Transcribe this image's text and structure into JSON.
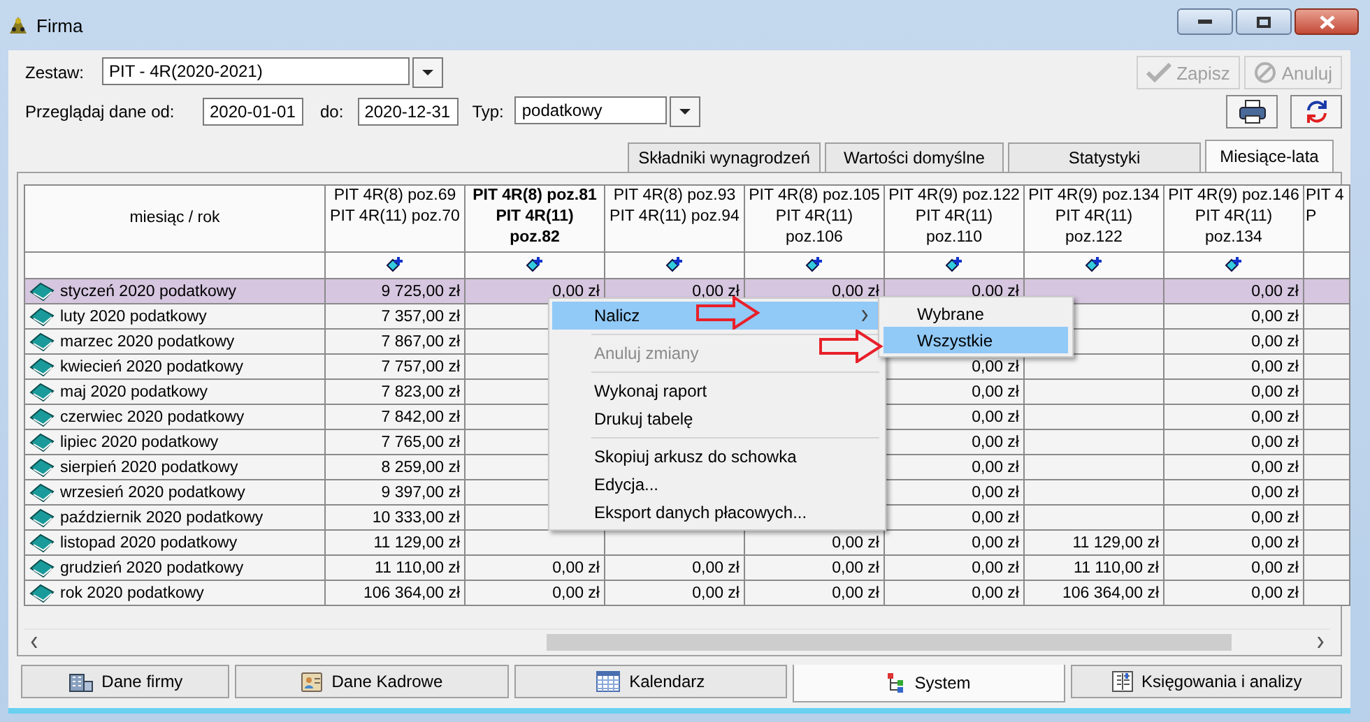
{
  "window": {
    "title": "Firma"
  },
  "form": {
    "set_label": "Zestaw:",
    "set_value": "PIT - 4R(2020-2021)",
    "from_label": "Przeglądaj dane od:",
    "from_value": "2020-01-01",
    "to_label": "do:",
    "to_value": "2020-12-31",
    "type_label": "Typ:",
    "type_value": "podatkowy"
  },
  "buttons": [
    {
      "label": "Zapisz",
      "disabled": true
    },
    {
      "label": "Anuluj",
      "disabled": true
    }
  ],
  "tabs": [
    {
      "label": "Składniki wynagrodzeń",
      "selected": false
    },
    {
      "label": "Wartości domyślne",
      "selected": false
    },
    {
      "label": "Statystyki",
      "selected": false
    },
    {
      "label": "Miesiące-lata",
      "selected": true
    }
  ],
  "table": {
    "corner_label": "miesiąc / rok",
    "columns": [
      {
        "label": "PIT 4R(8) poz.69\nPIT 4R(11) poz.70",
        "selected": false
      },
      {
        "label": "PIT 4R(8) poz.81\nPIT 4R(11)\npoz.82",
        "selected": true
      },
      {
        "label": "PIT 4R(8) poz.93\nPIT 4R(11) poz.94",
        "selected": false
      },
      {
        "label": "PIT 4R(8) poz.105\nPIT 4R(11)\npoz.106",
        "selected": false
      },
      {
        "label": "PIT 4R(9) poz.122\nPIT 4R(11)\npoz.110",
        "selected": false
      },
      {
        "label": "PIT 4R(9) poz.134\nPIT 4R(11)\npoz.122",
        "selected": false
      },
      {
        "label": "PIT 4R(9) poz.146\nPIT 4R(11)\npoz.134",
        "selected": false
      },
      {
        "label": "PIT 4\nP",
        "selected": false
      }
    ],
    "rows": [
      {
        "label": "styczeń 2020 podatkowy",
        "selected": true,
        "cells": [
          "9 725,00 zł",
          "0,00 zł",
          "0,00 zł",
          "0,00 zł",
          "0,00 zł",
          null,
          "0,00 zł"
        ]
      },
      {
        "label": "luty 2020 podatkowy",
        "selected": false,
        "cells": [
          "7 357,00 zł",
          null,
          null,
          null,
          null,
          null,
          "0,00 zł"
        ]
      },
      {
        "label": "marzec 2020 podatkowy",
        "selected": false,
        "cells": [
          "7 867,00 zł",
          null,
          null,
          null,
          null,
          null,
          "0,00 zł"
        ]
      },
      {
        "label": "kwiecień 2020 podatkowy",
        "selected": false,
        "cells": [
          "7 757,00 zł",
          null,
          null,
          null,
          "0,00 zł",
          null,
          "0,00 zł"
        ]
      },
      {
        "label": "maj 2020 podatkowy",
        "selected": false,
        "cells": [
          "7 823,00 zł",
          null,
          null,
          null,
          "0,00 zł",
          null,
          "0,00 zł"
        ]
      },
      {
        "label": "czerwiec 2020 podatkowy",
        "selected": false,
        "cells": [
          "7 842,00 zł",
          null,
          null,
          null,
          "0,00 zł",
          null,
          "0,00 zł"
        ]
      },
      {
        "label": "lipiec 2020 podatkowy",
        "selected": false,
        "cells": [
          "7 765,00 zł",
          null,
          null,
          null,
          "0,00 zł",
          null,
          "0,00 zł"
        ]
      },
      {
        "label": "sierpień 2020 podatkowy",
        "selected": false,
        "cells": [
          "8 259,00 zł",
          null,
          null,
          null,
          "0,00 zł",
          null,
          "0,00 zł"
        ]
      },
      {
        "label": "wrzesień 2020 podatkowy",
        "selected": false,
        "cells": [
          "9 397,00 zł",
          null,
          null,
          null,
          "0,00 zł",
          null,
          "0,00 zł"
        ]
      },
      {
        "label": "październik 2020 podatkowy",
        "selected": false,
        "cells": [
          "10 333,00 zł",
          null,
          null,
          null,
          "0,00 zł",
          null,
          "0,00 zł"
        ]
      },
      {
        "label": "listopad 2020 podatkowy",
        "selected": false,
        "cells": [
          "11 129,00 zł",
          null,
          null,
          "0,00 zł",
          "0,00 zł",
          "11 129,00 zł",
          "0,00 zł"
        ]
      },
      {
        "label": "grudzień 2020 podatkowy",
        "selected": false,
        "cells": [
          "11 110,00 zł",
          "0,00 zł",
          "0,00 zł",
          "0,00 zł",
          "0,00 zł",
          "11 110,00 zł",
          "0,00 zł"
        ]
      },
      {
        "label": "rok 2020 podatkowy",
        "selected": false,
        "cells": [
          "106 364,00 zł",
          "0,00 zł",
          "0,00 zł",
          "0,00 zł",
          "0,00 zł",
          "106 364,00 zł",
          "0,00 zł"
        ]
      }
    ]
  },
  "context_menu": {
    "items": [
      {
        "kind": "item",
        "label": "Nalicz",
        "selected": true,
        "disabled": false,
        "submenu": true
      },
      {
        "kind": "separator"
      },
      {
        "kind": "item",
        "label": "Anuluj zmiany",
        "selected": false,
        "disabled": true,
        "submenu": false
      },
      {
        "kind": "separator"
      },
      {
        "kind": "item",
        "label": "Wykonaj raport",
        "selected": false,
        "disabled": false,
        "submenu": false
      },
      {
        "kind": "item",
        "label": "Drukuj tabelę",
        "selected": false,
        "disabled": false,
        "submenu": false
      },
      {
        "kind": "separator"
      },
      {
        "kind": "item",
        "label": "Skopiuj arkusz do schowka",
        "selected": false,
        "disabled": false,
        "submenu": false
      },
      {
        "kind": "item",
        "label": "Edycja...",
        "selected": false,
        "disabled": false,
        "submenu": false
      },
      {
        "kind": "item",
        "label": "Eksport danych płacowych...",
        "selected": false,
        "disabled": false,
        "submenu": false
      }
    ],
    "submenu": [
      {
        "label": "Wybrane",
        "selected": false
      },
      {
        "label": "Wszystkie",
        "selected": true
      }
    ]
  },
  "bottom_tabs": [
    {
      "label": "Dane firmy",
      "selected": false
    },
    {
      "label": "Dane Kadrowe",
      "selected": false
    },
    {
      "label": "Kalendarz",
      "selected": false
    },
    {
      "label": "System",
      "selected": true
    },
    {
      "label": "Księgowania i analizy",
      "selected": false
    }
  ]
}
